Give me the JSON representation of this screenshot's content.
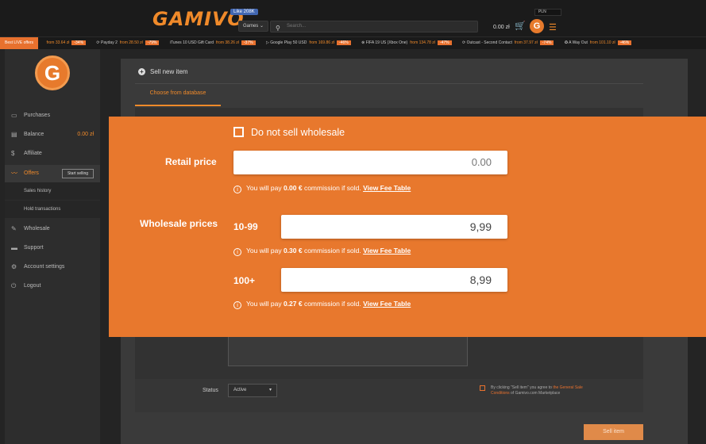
{
  "header": {
    "logo_text": "GAMIVO",
    "like_label": "Like 208K",
    "games_label": "Games ⌄",
    "search_placeholder": "Search...",
    "currency": "PLN",
    "wallet": "0.00 zł",
    "accent_color": "#e8782d"
  },
  "ticker": {
    "first_label": "Best LIVE offers",
    "items": [
      {
        "name": "",
        "price": "from 33.64 zł",
        "discount": "-34%"
      },
      {
        "name": "Payday 2",
        "price": "from 28.50 zł",
        "discount": "-79%"
      },
      {
        "name": "iTunes 10 USD Gift Card",
        "price": "from 38.26 zł",
        "discount": "-37%"
      },
      {
        "name": "Google Play 50 USD",
        "price": "from 169.86 zł",
        "discount": "-46%"
      },
      {
        "name": "FIFA 19 US (Xbox One)",
        "price": "from 134.78 zł",
        "discount": "-47%"
      },
      {
        "name": "Outcast - Second Contact",
        "price": "from 37.97 zł",
        "discount": "-74%"
      },
      {
        "name": "A Way Out",
        "price": "from 101.10 zł",
        "discount": "-46%"
      }
    ]
  },
  "sidebar": {
    "avatar_letter": "G",
    "items": [
      {
        "label": "Purchases",
        "icon": "card-icon"
      },
      {
        "label": "Balance",
        "icon": "wallet-icon",
        "value": "0.00 zł"
      },
      {
        "label": "Affiliate",
        "icon": "dollar-icon"
      },
      {
        "label": "Offers",
        "icon": "chart-line-icon",
        "button": "Start selling"
      },
      {
        "label": "Wholesale",
        "icon": "handshake-icon"
      },
      {
        "label": "Support",
        "icon": "chat-icon"
      },
      {
        "label": "Account settings",
        "icon": "gear-icon"
      },
      {
        "label": "Logout",
        "icon": "power-icon"
      }
    ],
    "sub_items": [
      "Sales history",
      "Hold transactions"
    ]
  },
  "main": {
    "title": "Sell new item",
    "tab_label": "Choose from database",
    "status_label": "Status",
    "status_value": "Active",
    "agree_text_1": "By clicking \"Sell item\" you agree to ",
    "agree_link": "the General Sale Conditions",
    "agree_text_2": " of Gamivo.com Marketplace",
    "sell_button": "Sell item"
  },
  "overlay": {
    "no_wholesale_label": "Do not sell wholesale",
    "retail_label": "Retail price",
    "retail_value": "0.00",
    "retail_note_pre": "You will pay ",
    "retail_note_amount": "0.00 €",
    "retail_note_post": " commission if sold. ",
    "fee_link": "View Fee Table",
    "wholesale_label": "Wholesale prices",
    "tiers": [
      {
        "range": "10-99",
        "value": "9,99",
        "note_pre": "You will pay ",
        "amount": "0.30 €",
        "note_post": " commission if sold. "
      },
      {
        "range": "100+",
        "value": "8,99",
        "note_pre": "You will pay ",
        "amount": "0.27 €",
        "note_post": " commission if sold. "
      }
    ]
  }
}
